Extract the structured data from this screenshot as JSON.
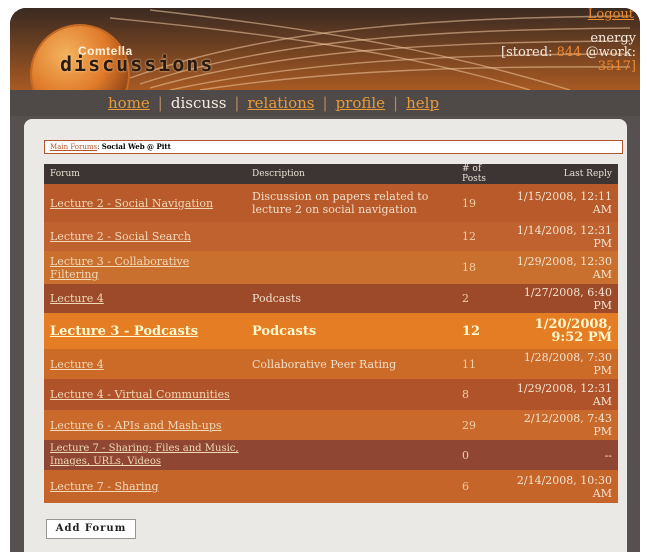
{
  "header": {
    "logo_small": "Comtella",
    "logo_big": "discussions",
    "logout": "Logout",
    "user_name": "energy",
    "stored_label": "[stored:",
    "stored_value": "844",
    "work_label": "@work:",
    "work_value": "3517]"
  },
  "nav": {
    "items": [
      "home",
      "discuss",
      "relations",
      "profile",
      "help"
    ],
    "current": "discuss"
  },
  "breadcrumb": {
    "link": "Main Forums",
    "separator": ":",
    "current": "Social Web @ Pitt"
  },
  "table": {
    "headers": [
      "Forum",
      "Description",
      "# of Posts",
      "Last Reply"
    ],
    "rows": [
      {
        "forum": "Lecture 2 - Social Navigation",
        "description": "Discussion on papers related to lecture 2 on social navigation",
        "posts": "19",
        "last_reply": "1/15/2008, 12:11 AM"
      },
      {
        "forum": "Lecture 2 - Social Search",
        "description": "",
        "posts": "12",
        "last_reply": "1/14/2008, 12:31 PM"
      },
      {
        "forum": "Lecture 3 - Collaborative Filtering",
        "description": "",
        "posts": "18",
        "last_reply": "1/29/2008, 12:30 AM"
      },
      {
        "forum": "Lecture 4",
        "description": "Podcasts",
        "posts": "2",
        "last_reply": "1/27/2008, 6:40 PM"
      },
      {
        "forum": "Lecture 3 - Podcasts",
        "description": "Podcasts",
        "posts": "12",
        "last_reply": "1/20/2008, 9:52 PM"
      },
      {
        "forum": "Lecture 4",
        "description": "Collaborative Peer Rating",
        "posts": "11",
        "last_reply": "1/28/2008, 7:30 PM"
      },
      {
        "forum": "Lecture 4 - Virtual Communities",
        "description": "",
        "posts": "8",
        "last_reply": "1/29/2008, 12:31 AM"
      },
      {
        "forum": "Lecture 6 - APIs and Mash-ups",
        "description": "",
        "posts": "29",
        "last_reply": "2/12/2008, 7:43 PM"
      },
      {
        "forum": "Lecture 7 - Sharing: Files and Music, Images, URLs, Videos",
        "description": "",
        "posts": "0",
        "last_reply": "--"
      },
      {
        "forum": "Lecture 7 - Sharing",
        "description": "",
        "posts": "6",
        "last_reply": "2/14/2008, 10:30 AM"
      }
    ]
  },
  "add_forum_label": "Add Forum",
  "colors": {
    "row_colors": [
      "#b85a2a",
      "#bf6230",
      "#c9702f",
      "#9c4a2a",
      "#e57d24",
      "#cc6a28",
      "#b0532a",
      "#c9692b",
      "#8f4632",
      "#c5652a"
    ],
    "accent": "#f08a2d"
  }
}
